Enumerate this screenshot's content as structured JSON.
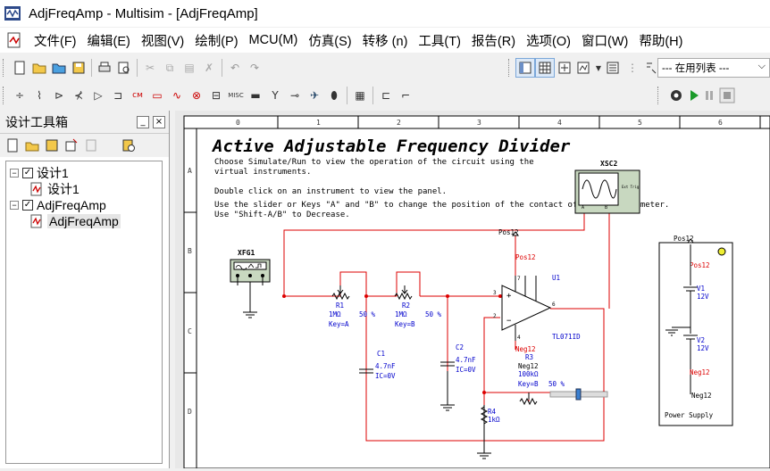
{
  "window": {
    "title": "AdjFreqAmp - Multisim - [AdjFreqAmp]"
  },
  "menus": [
    "文件(F)",
    "编辑(E)",
    "视图(V)",
    "绘制(P)",
    "MCU(M)",
    "仿真(S)",
    "转移 (n)",
    "工具(T)",
    "报告(R)",
    "选项(O)",
    "窗口(W)",
    "帮助(H)"
  ],
  "toolbar": {
    "in_use_list": "--- 在用列表 ---"
  },
  "panel": {
    "title": "设计工具箱",
    "pin_label": "_",
    "close_label": "×"
  },
  "tree": [
    {
      "label": "设计1",
      "level": 0
    },
    {
      "label": "设计1",
      "level": 1
    },
    {
      "label": "AdjFreqAmp",
      "level": 0
    },
    {
      "label": "AdjFreqAmp",
      "level": 1,
      "selected": true
    }
  ],
  "ruler": {
    "columns": [
      "0",
      "1",
      "2",
      "3",
      "4",
      "5",
      "6"
    ],
    "rows": [
      "A",
      "B",
      "C",
      "D"
    ]
  },
  "schematic": {
    "title": "Active Adjustable Frequency Divider",
    "instructions": [
      "Choose Simulate/Run to view the operation of the circuit using the",
      "virtual instruments.",
      "Double click on an instrument to view the panel.",
      "Use the slider or Keys \"A\" and \"B\" to change the position of the contact of the potentiometer.",
      "Use \"Shift-A/B\" to Decrease."
    ],
    "xfg1": "XFG1",
    "xsc2": "XSC2",
    "xsc2_ext": "Ext Trig",
    "xsc2_a": "A",
    "xsc2_b": "B",
    "r1": {
      "name": "R1",
      "value": "1MΩ",
      "percent": "50 %",
      "key": "Key=A"
    },
    "r2": {
      "name": "R2",
      "value": "1MΩ",
      "percent": "50 %",
      "key": "Key=B"
    },
    "r3": {
      "name": "R3",
      "value": "100kΩ",
      "key": "Key=B",
      "percent": "50 %"
    },
    "r4": {
      "name": "R4",
      "value": "1kΩ"
    },
    "c1": {
      "name": "C1",
      "value": "4.7nF",
      "ic": "IC=0V"
    },
    "c2": {
      "name": "C2",
      "value": "4.7nF",
      "ic": "IC=0V"
    },
    "u1": {
      "name": "U1",
      "part": "TL071ID"
    },
    "pos12": "Pos12",
    "neg12": "Neg12",
    "pin3": "3",
    "pin2": "2",
    "pin6": "6",
    "pin7": "7",
    "pin4": "4",
    "psu": {
      "v1": "V1",
      "v1v": "12V",
      "v2": "V2",
      "v2v": "12V",
      "label": "Power Supply"
    }
  }
}
